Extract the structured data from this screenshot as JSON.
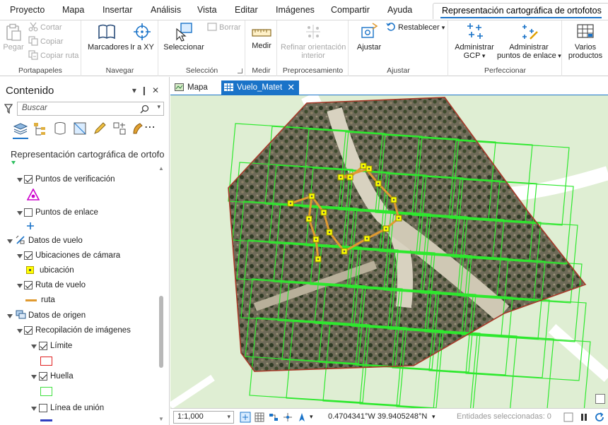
{
  "ribbon_tabs": [
    "Proyecto",
    "Mapa",
    "Insertar",
    "Análisis",
    "Vista",
    "Editar",
    "Imágenes",
    "Compartir",
    "Ayuda",
    "Representación cartográfica de ortofotos"
  ],
  "groups": {
    "portapapeles": {
      "label": "Portapapeles",
      "pegar": "Pegar",
      "cortar": "Cortar",
      "copiar": "Copiar",
      "copiar_ruta": "Copiar ruta"
    },
    "navegar": {
      "label": "Navegar",
      "marcadores": "Marcadores",
      "ir_xy": "Ir a XY"
    },
    "seleccion": {
      "label": "Selección",
      "seleccionar": "Seleccionar",
      "borrar": "Borrar"
    },
    "medir": {
      "label": "Medir",
      "medir_btn": "Medir"
    },
    "preprocesamiento": {
      "label": "Preprocesamiento",
      "refinar_l1": "Refinar orientación",
      "refinar_l2": "interior"
    },
    "ajustar": {
      "label": "Ajustar",
      "ajustar_btn": "Ajustar",
      "restablecer": "Restablecer"
    },
    "perfeccionar": {
      "label": "Perfeccionar",
      "admin_gcp_l1": "Administrar",
      "admin_gcp_l2": "GCP",
      "admin_pe_l1": "Administrar",
      "admin_pe_l2": "puntos de enlace"
    },
    "varios": {
      "l1": "Varios",
      "l2": "productos"
    }
  },
  "contents": {
    "title": "Contenido",
    "search_placeholder": "Buscar",
    "map_title": "Representación cartográfica de ortofo",
    "rows": {
      "puntos_verificacion": "Puntos de verificación",
      "puntos_enlace": "Puntos de enlace",
      "datos_vuelo": "Datos de vuelo",
      "ubicaciones_camara": "Ubicaciones de cámara",
      "ubicacion": "ubicación",
      "ruta_vuelo": "Ruta de vuelo",
      "ruta": "ruta",
      "datos_origen": "Datos de origen",
      "recopilacion": "Recopilación de imágenes",
      "limite": "Límite",
      "huella": "Huella",
      "linea_union": "Línea de unión"
    },
    "colors": {
      "check": "#cc00cc",
      "enlace": "#1a73c8",
      "ubicacion": "#ffff00",
      "ruta": "#e09a30",
      "limite": "#e02020",
      "huella": "#40e040",
      "union": "#3040c0"
    }
  },
  "doc_tabs": {
    "mapa": "Mapa",
    "vuelo": "Vuelo_Matet"
  },
  "status": {
    "scale": "1:1,000",
    "coords": "0.4704341°W 39.9405248°N",
    "selected": "Entidades seleccionadas: 0"
  }
}
